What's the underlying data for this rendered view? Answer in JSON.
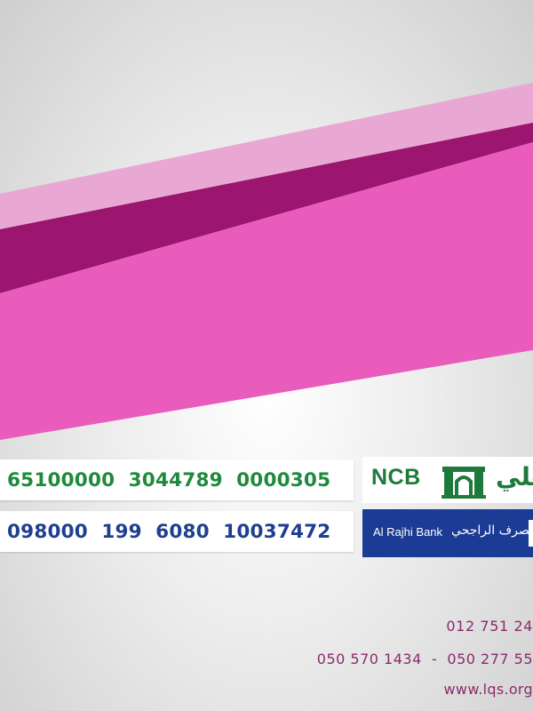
{
  "colors": {
    "light_pink_band": "#e9a8d4",
    "dark_magenta_band": "#9c1670",
    "pink_band": "#e95cbb",
    "ncb_green": "#1e8a3c",
    "rajhi_blue": "#1b3b94",
    "contact_purple": "#8c2a6d"
  },
  "accounts": {
    "ncb": {
      "number": "65100000  3044789  0000305"
    },
    "rajhi": {
      "number": "098000  199  6080  10037472"
    }
  },
  "logos": {
    "ncb": {
      "text": "NCB",
      "arabic": "الأهلي",
      "icon": "gate-icon"
    },
    "rajhi": {
      "text_en": "Al Rajhi Bank",
      "text_ar": "مصرف الراجحي"
    }
  },
  "contact": {
    "landline": "012 751 24",
    "mobiles": "050 570 1434  -  050 277 55",
    "website": "www.lqs.org"
  }
}
